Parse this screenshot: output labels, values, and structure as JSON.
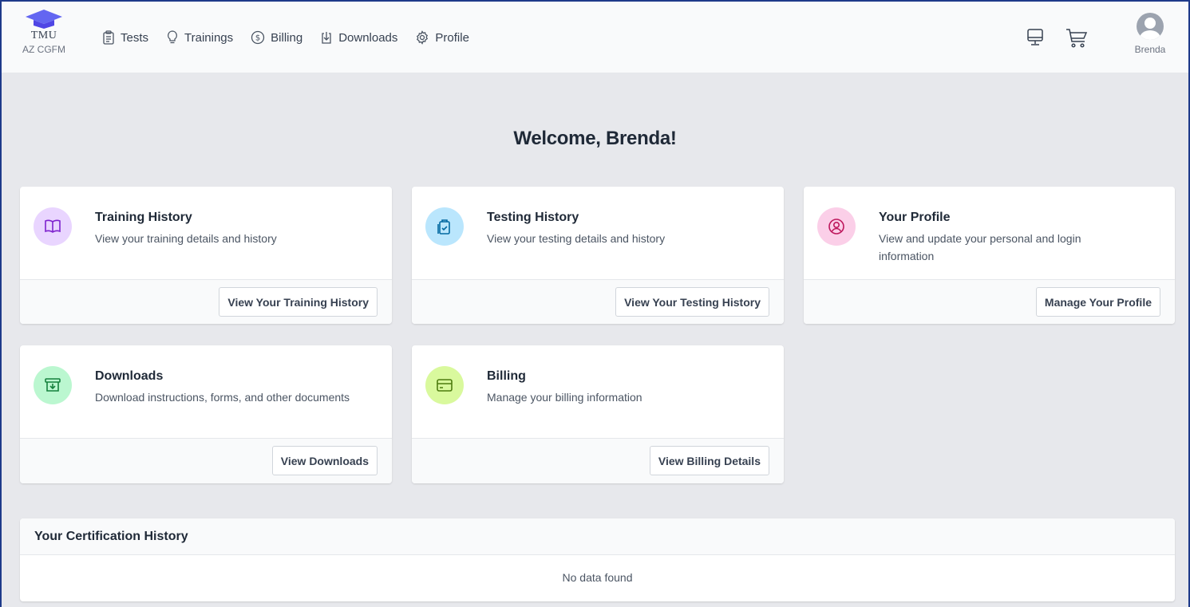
{
  "brand": {
    "name": "TMU",
    "org": "AZ CGFM"
  },
  "nav": [
    {
      "label": "Tests",
      "icon": "clipboard-icon"
    },
    {
      "label": "Trainings",
      "icon": "lightbulb-icon"
    },
    {
      "label": "Billing",
      "icon": "dollar-icon"
    },
    {
      "label": "Downloads",
      "icon": "download-icon"
    },
    {
      "label": "Profile",
      "icon": "gear-icon"
    }
  ],
  "user": {
    "name": "Brenda"
  },
  "welcome": "Welcome, Brenda!",
  "cards": [
    {
      "title": "Training History",
      "desc": "View your training details and history",
      "button": "View Your Training History",
      "icon": "book-icon",
      "color": "#e9d5ff"
    },
    {
      "title": "Testing History",
      "desc": "View your testing details and history",
      "button": "View Your Testing History",
      "icon": "clipboard-check-icon",
      "color": "#bae6fd"
    },
    {
      "title": "Your Profile",
      "desc": "View and update your personal and login information",
      "button": "Manage Your Profile",
      "icon": "user-circle-icon",
      "color": "#fbcfe8"
    },
    {
      "title": "Downloads",
      "desc": "Download instructions, forms, and other documents",
      "button": "View Downloads",
      "icon": "archive-icon",
      "color": "#bbf7d0"
    },
    {
      "title": "Billing",
      "desc": "Manage your billing information",
      "button": "View Billing Details",
      "icon": "credit-card-icon",
      "color": "#d9f99d"
    }
  ],
  "certification": {
    "title": "Your Certification History",
    "empty": "No data found"
  }
}
